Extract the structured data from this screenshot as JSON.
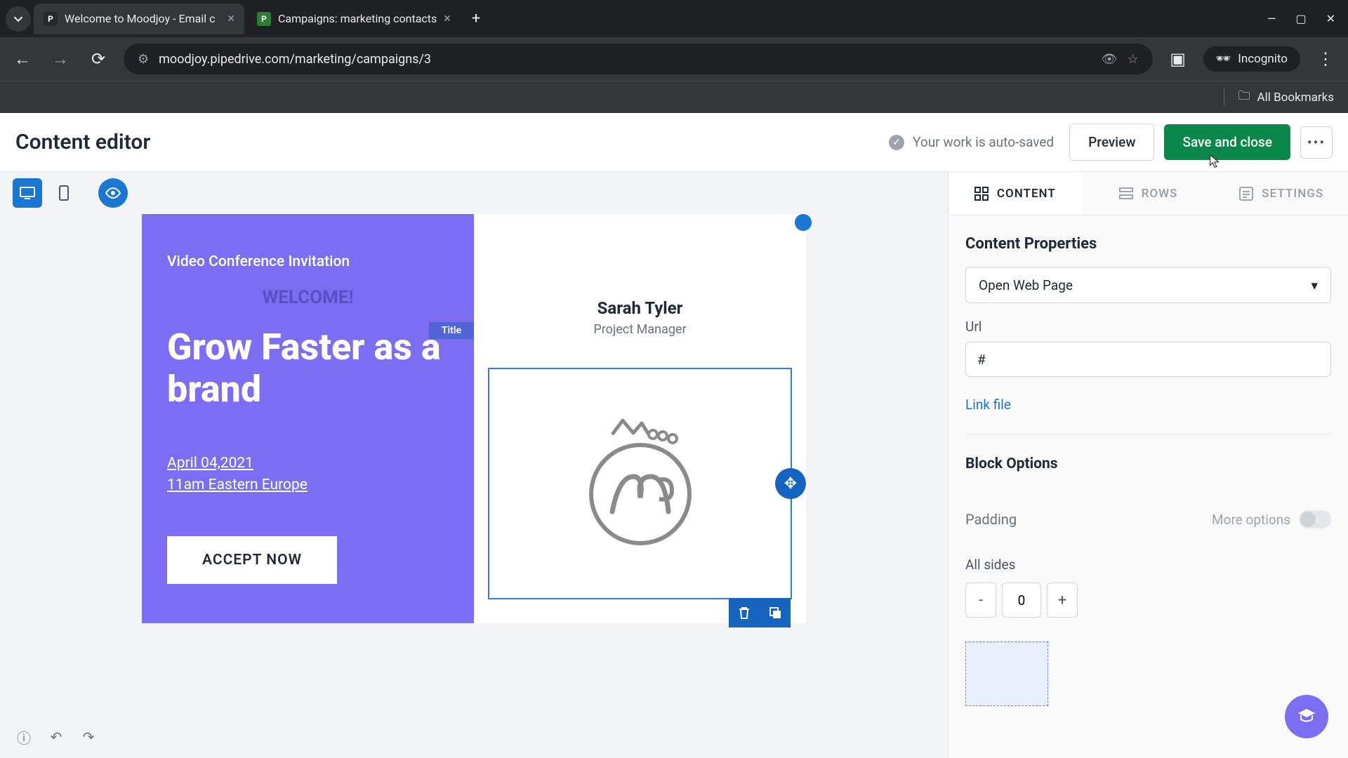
{
  "browser": {
    "tabs": [
      {
        "title": "Welcome to Moodjoy - Email c",
        "favicon": "P"
      },
      {
        "title": "Campaigns: marketing contacts",
        "favicon": "P"
      }
    ],
    "url": "moodjoy.pipedrive.com/marketing/campaigns/3",
    "incognito_label": "Incognito",
    "all_bookmarks": "All Bookmarks"
  },
  "header": {
    "title": "Content editor",
    "autosave": "Your work is auto-saved",
    "preview": "Preview",
    "save": "Save and close"
  },
  "panel": {
    "tabs": {
      "content": "CONTENT",
      "rows": "ROWS",
      "settings": "SETTINGS"
    },
    "properties_title": "Content Properties",
    "action_select": "Open Web Page",
    "url_label": "Url",
    "url_value": "#",
    "link_file": "Link file",
    "block_options": "Block Options",
    "padding": "Padding",
    "more_options": "More options",
    "all_sides": "All sides",
    "pad_value": "0"
  },
  "email": {
    "invite": "Video Conference Invitation",
    "welcome": "WELCOME!",
    "title_badge": "Title",
    "headline": "Grow Faster as a brand",
    "date": "April 04,2021",
    "time": "11am Eastern Europe",
    "cta": "ACCEPT NOW",
    "person_name": "Sarah Tyler",
    "person_role": "Project Manager"
  }
}
